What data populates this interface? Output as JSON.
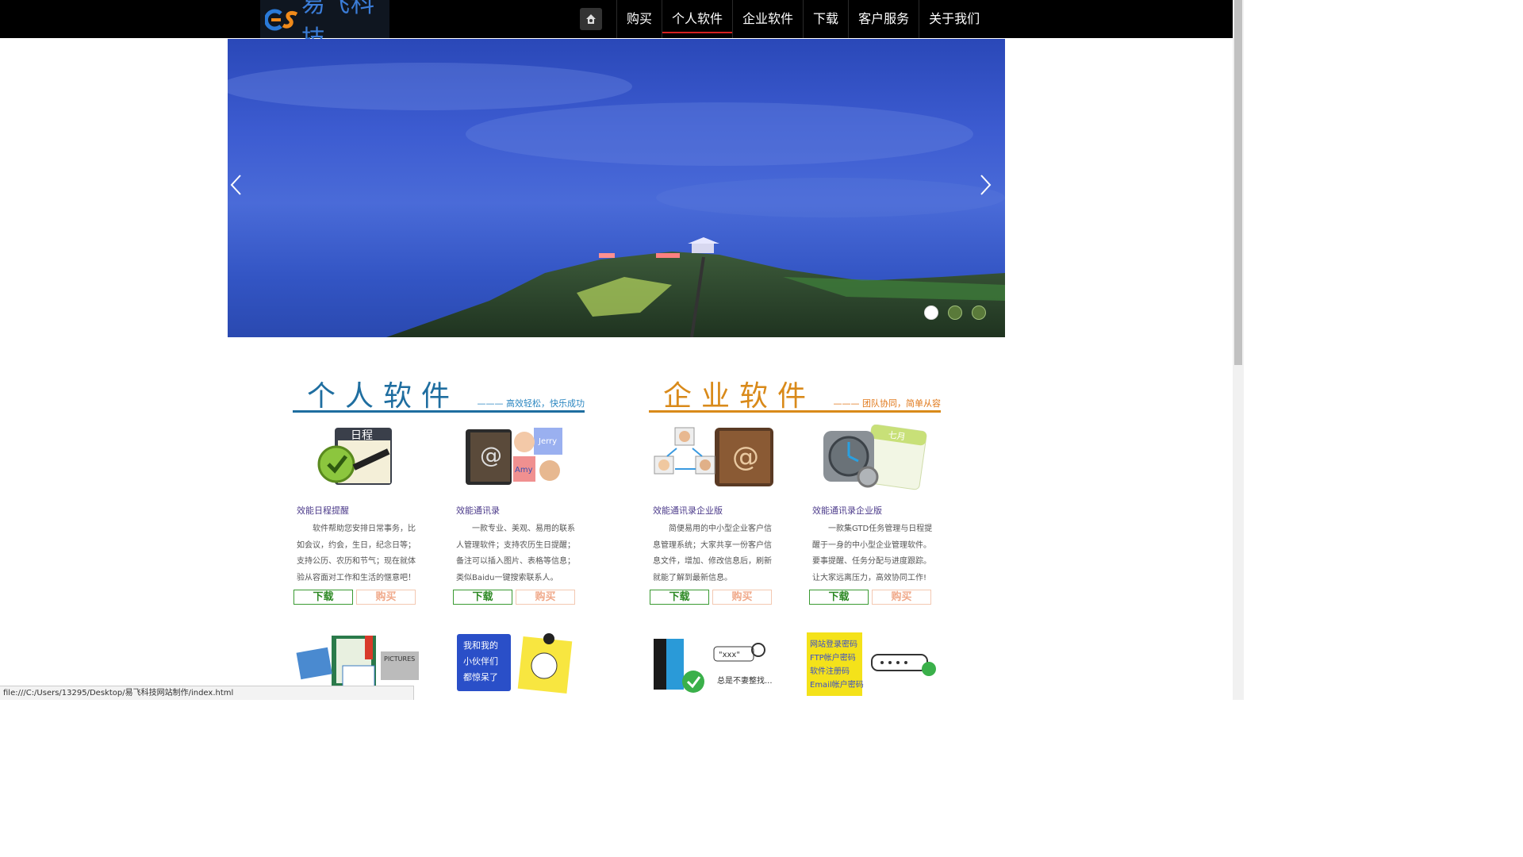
{
  "header": {
    "logo_text": "易飞科技",
    "nav": [
      "购买",
      "个人软件",
      "企业软件",
      "下载",
      "客户服务",
      "关于我们"
    ],
    "active_index": 1
  },
  "banner": {
    "slide_count": 3,
    "active_slide": 0
  },
  "sections": [
    {
      "title": "个人软件",
      "subtitle": "——— 高效轻松，快乐成功",
      "color": "#1f6ea0",
      "products": [
        {
          "name": "效能日程提醒",
          "desc": "软件帮助您安排日常事务，比如会议，约会，生日，纪念日等；支持公历、农历和节气；现在就体验从容面对工作和生活的惬意吧！",
          "download": "下载",
          "buy": "购买"
        },
        {
          "name": "效能通讯录",
          "desc": "一款专业、美观、易用的联系人管理软件；支持农历生日提醒；备注可以插入图片、表格等信息；类似Baidu一键搜索联系人。",
          "download": "下载",
          "buy": "购买"
        }
      ]
    },
    {
      "title": "企业软件",
      "subtitle": "——— 团队协同，简单从容",
      "color": "#d98a1a",
      "products": [
        {
          "name": "效能通讯录企业版",
          "desc": "简便易用的中小型企业客户信息管理系统；大家共享一份客户信息文件，增加、修改信息后，刷新就能了解到最新信息。",
          "download": "下载",
          "buy": "购买"
        },
        {
          "name": "效能通讯录企业版",
          "desc": "一款集GTD任务管理与日程提醒于一身的中小型企业管理软件。要事提醒、任务分配与进度跟踪。让大家远离压力，高效协同工作!",
          "download": "下载",
          "buy": "购买"
        }
      ]
    }
  ],
  "row2": {
    "note_text": [
      "我和我的",
      "小伙伴们",
      "都惊呆了"
    ],
    "search_text": "\"xxx\"",
    "search_caption": "总是不妻整找...",
    "password_lines": [
      "网站登录密码",
      "FTP帐户密码",
      "软件注册码",
      "Email帐户密码"
    ],
    "pictures_label": "PICTURES"
  },
  "product_icons": {
    "calendar_label": "日程",
    "contact_names": [
      "Jerry",
      "Amy"
    ],
    "month_label": "七月"
  },
  "statusbar": {
    "url": "file:///C:/Users/13295/Desktop/易飞科技网站制作/index.html"
  }
}
